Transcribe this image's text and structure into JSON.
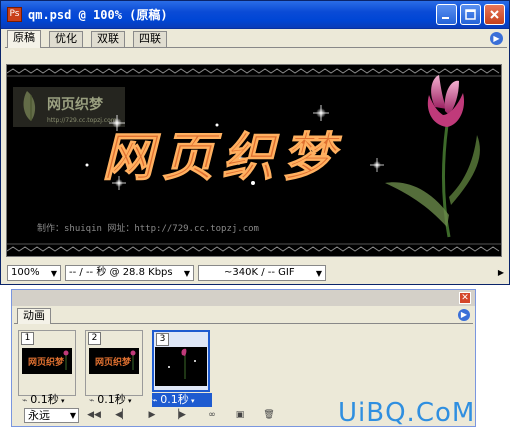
{
  "window": {
    "title": "qm.psd @ 100% (原稿)",
    "title_icon": "photoshop-doc-icon",
    "controls": [
      "minimize-icon",
      "maximize-icon",
      "close-icon"
    ]
  },
  "tabs": [
    {
      "label": "原稿",
      "active": true
    },
    {
      "label": "优化",
      "active": false
    },
    {
      "label": "双联",
      "active": false
    },
    {
      "label": "四联",
      "active": false
    }
  ],
  "canvas": {
    "logo_text": "网页织梦",
    "logo_url": "http://729.cc.topzj.com",
    "headline": "网页织梦",
    "credit": "制作：shuiqin  网址：http://729.cc.topzj.com"
  },
  "status": {
    "zoom": "100%",
    "download": "-- / -- 秒 @ 28.8 Kbps",
    "size": "~340K / -- GIF"
  },
  "animation_panel": {
    "tab_label": "动画",
    "frames": [
      {
        "number": "1",
        "delay": "0.1秒",
        "selected": false
      },
      {
        "number": "2",
        "delay": "0.1秒",
        "selected": false
      },
      {
        "number": "3",
        "delay": "0.1秒",
        "selected": true
      }
    ],
    "loop": "永远",
    "tools": [
      "first-frame-icon",
      "prev-frame-icon",
      "play-icon",
      "next-frame-icon",
      "tween-icon",
      "new-frame-icon",
      "delete-frame-icon"
    ]
  },
  "watermark": "UiBQ.CoM",
  "colors": {
    "title_bar": "#0a4bd6",
    "canvas_bg": "#000000",
    "headline_orange": "#e07030",
    "tulip_pink": "#d0488a",
    "selection_blue": "#1e5bd0",
    "watermark_blue": "#2f8fe0"
  }
}
